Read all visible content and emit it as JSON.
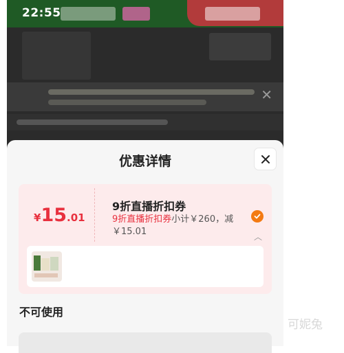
{
  "status_bar": {
    "time": "22:55"
  },
  "sheet": {
    "title": "优惠详情",
    "close_icon": "close-icon",
    "coupon": {
      "currency_symbol": "¥",
      "amount_int": "15",
      "amount_dec": ".01",
      "name": "9折直播折扣券",
      "tag": "9折直播折扣券",
      "desc": "小计￥260，减￥15.01",
      "selected": true,
      "accent_color": "#e8303e",
      "check_color": "#f37a12"
    },
    "unavailable_title": "不可使用"
  },
  "watermark": "可妮兔"
}
